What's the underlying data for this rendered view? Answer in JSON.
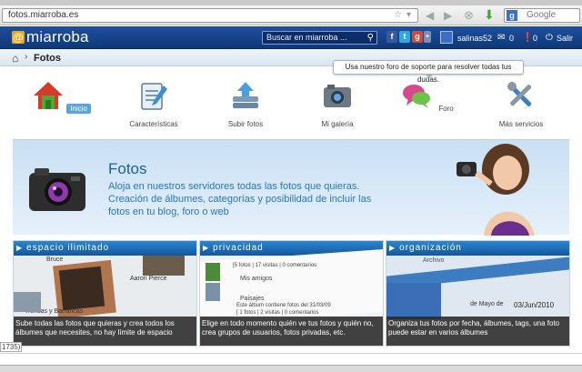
{
  "browser": {
    "url": "fotos.miarroba.es",
    "search_engine_letter": "g",
    "search_placeholder": "Google"
  },
  "site": {
    "logo_symbol": "@",
    "logo_text": "miarroba",
    "search_placeholder": "Buscar en miarroba ...",
    "username": "salinas52",
    "messages_count": "0",
    "alerts_count": "0",
    "logout_label": "Salir"
  },
  "breadcrumb": {
    "title": "Fotos"
  },
  "tooltip": "Usa nuestro foro de soporte para resolver todas tus dudas.",
  "nav": [
    {
      "label": "Inicio",
      "icon": "home-icon",
      "active": true
    },
    {
      "label": "Características",
      "icon": "edit-icon",
      "active": false
    },
    {
      "label": "Subir fotos",
      "icon": "upload-icon",
      "active": false
    },
    {
      "label": "Mi galería",
      "icon": "camera-icon",
      "active": false
    },
    {
      "label": "Foro",
      "icon": "chat-icon",
      "active": false
    },
    {
      "label": "Más servicios",
      "icon": "tools-icon",
      "active": false
    }
  ],
  "hero": {
    "title": "Fotos",
    "description": "Aloja en nuestros servidores todas las fotos que quieras. Creación de álbumes, categorías y posibilidad de incluir las fotos en tu blog, foro o web"
  },
  "panels": [
    {
      "title": "espacio ilimitado",
      "caption": "Sube todas las fotos que quieras y crea todos los álbumes que necesites, no hay límite de espacio",
      "preview_labels": [
        "Bruce",
        "Aaron Pierce",
        "Trencas y Barrancas"
      ]
    },
    {
      "title": "privacidad",
      "caption": "Elige en todo momento quién ve tus fotos y quién no, crea grupos de usuarios, fotos privadas, etc.",
      "preview_labels": [
        "[5 fotos | 17 visitas | 0 comentarios",
        "Mis amigos",
        "Paisajes",
        "Este álbum contiene fotos del 31/03/09",
        "[ 1 fotos | 2 visitas | 0 comentarios"
      ]
    },
    {
      "title": "organización",
      "caption": "Organiza tus fotos por fecha, álbumes, tags, una foto puede estar en varios álbumes",
      "preview_labels": [
        "Archivo",
        "de Mayo de",
        "03/Jun/2010"
      ]
    }
  ],
  "footer": {
    "tab_text": "1735)"
  },
  "colors": {
    "header_blue": "#14459a",
    "accent_orange": "#f0a818",
    "panel_header_blue": "#1a6ab8",
    "hero_text_blue": "#2a76bd"
  }
}
